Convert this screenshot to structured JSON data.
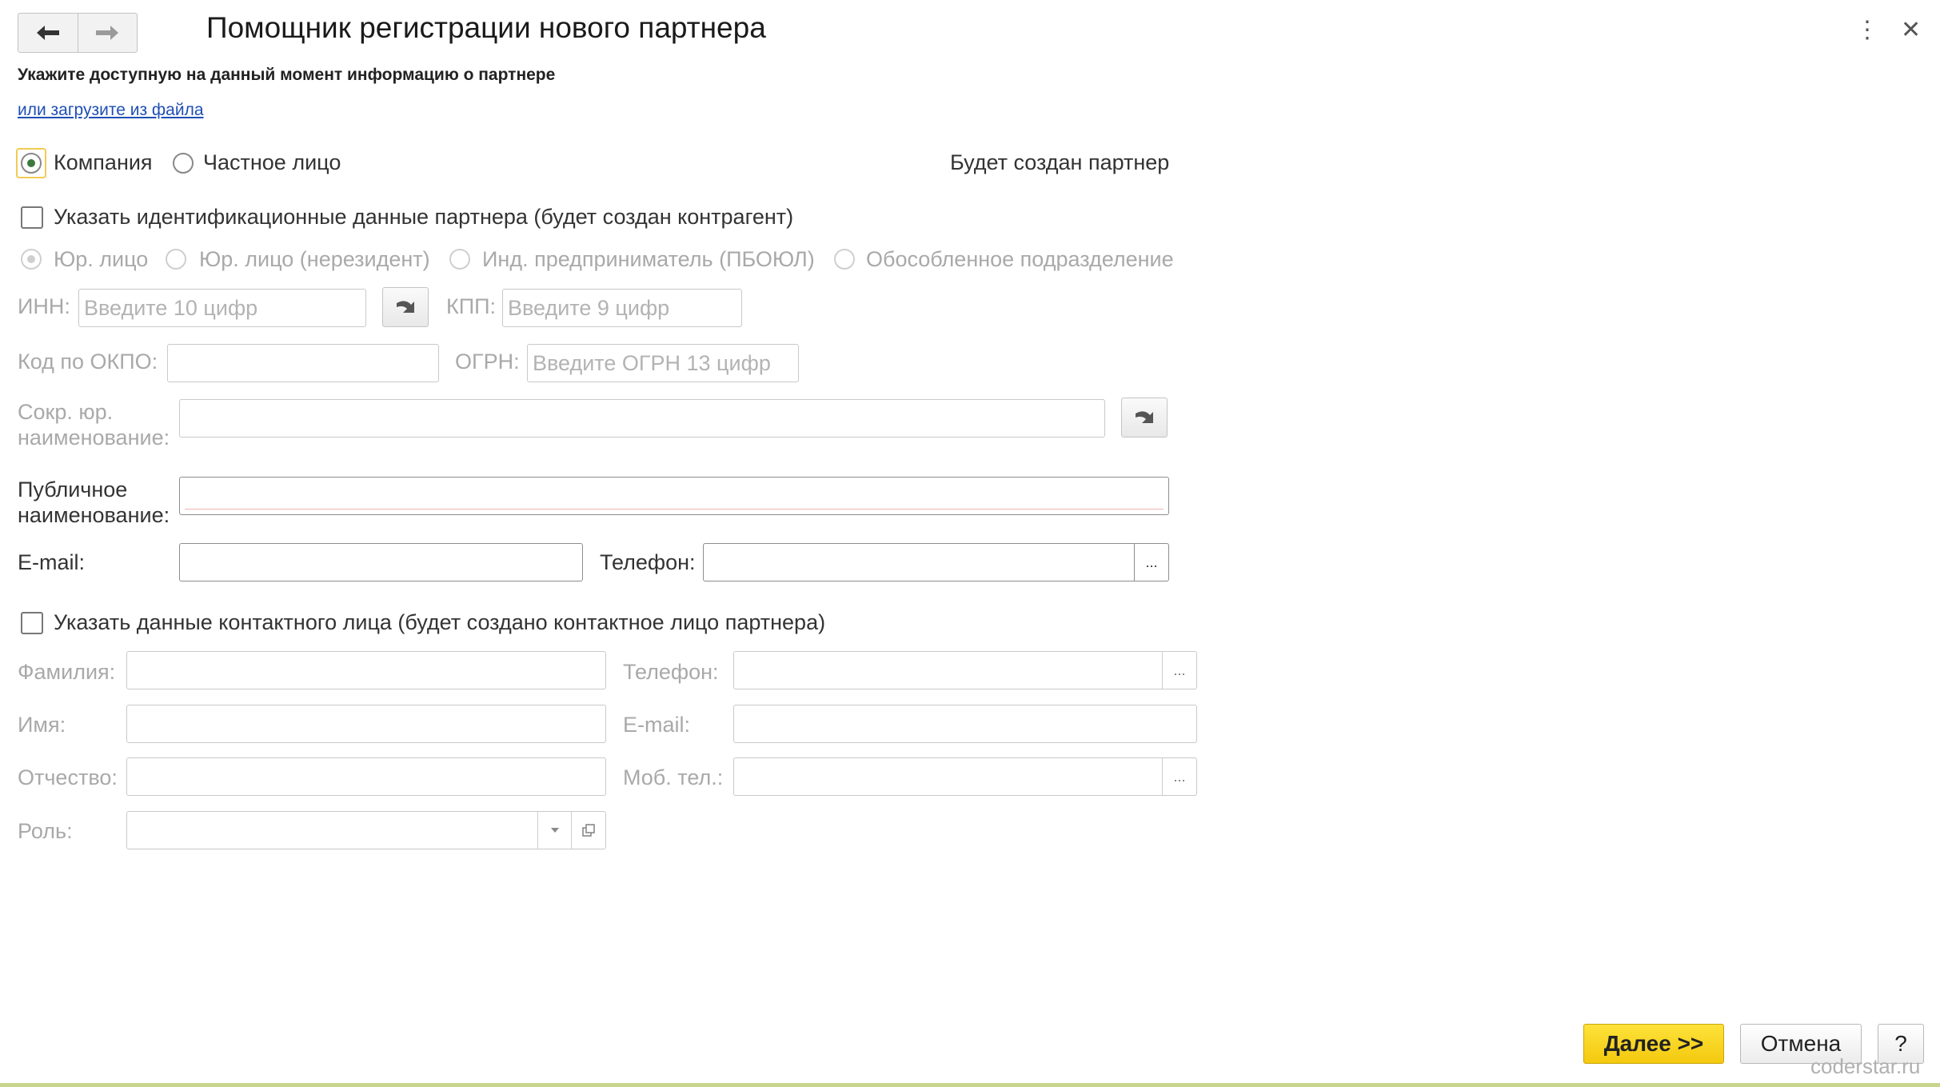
{
  "header": {
    "title": "Помощник регистрации нового партнера",
    "subtitle": "Укажите доступную на данный момент информацию о партнере",
    "load_link": "или загрузите из файла"
  },
  "partner_kind": {
    "options": [
      "Компания",
      "Частное лицо"
    ],
    "selected": "Компания",
    "status_text": "Будет создан партнер"
  },
  "identification": {
    "checkbox_label": "Указать идентификационные данные партнера (будет создан контрагент)",
    "checked": false,
    "types": [
      "Юр. лицо",
      "Юр. лицо (нерезидент)",
      "Инд. предприниматель (ПБОЮЛ)",
      "Обособленное подразделение"
    ],
    "selected_type": "Юр. лицо",
    "inn_label": "ИНН:",
    "inn_placeholder": "Введите 10 цифр",
    "kpp_label": "КПП:",
    "kpp_placeholder": "Введите 9 цифр",
    "okpo_label": "Код по ОКПО:",
    "okpo_value": "",
    "ogrn_label": "ОГРН:",
    "ogrn_placeholder": "Введите ОГРН 13 цифр",
    "short_name_label_1": "Сокр. юр.",
    "short_name_label_2": "наименование:",
    "short_name_value": ""
  },
  "public": {
    "label_1": "Публичное",
    "label_2": "наименование:",
    "value": "",
    "email_label": "E-mail:",
    "email_value": "",
    "phone_label": "Телефон:",
    "phone_value": "",
    "select_button": "..."
  },
  "contact": {
    "checkbox_label": "Указать данные контактного лица (будет создано контактное лицо партнера)",
    "checked": false,
    "surname_label": "Фамилия:",
    "name_label": "Имя:",
    "patronymic_label": "Отчество:",
    "role_label": "Роль:",
    "phone_label": "Телефон:",
    "email_label": "E-mail:",
    "mobile_label": "Моб. тел.:",
    "select_button": "..."
  },
  "footer": {
    "next_button": "Далее >>",
    "cancel_button": "Отмена",
    "help_button": "?",
    "watermark": "coderstar.ru"
  },
  "colors": {
    "accent_yellow": "#f4c90f",
    "link_blue": "#1f4fb4",
    "radio_green": "#3c7a3c"
  }
}
